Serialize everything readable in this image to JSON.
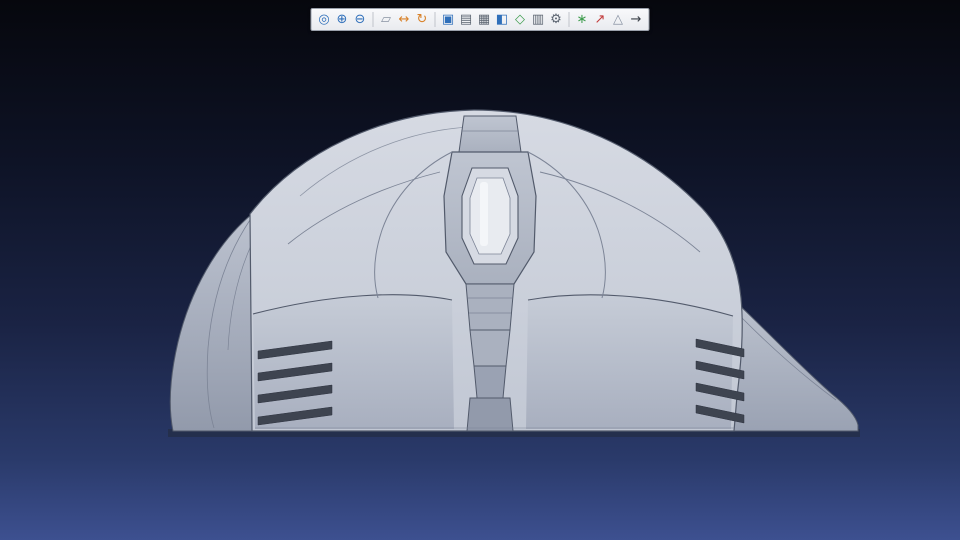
{
  "window": {
    "bg_top": "#06070d",
    "bg_bottom": "#3d5090"
  },
  "toolbar": {
    "items": [
      {
        "id": "zoom",
        "glyph": "◎",
        "color": "#2f6fba"
      },
      {
        "id": "zoom-in",
        "glyph": "⊕",
        "color": "#2f6fba"
      },
      {
        "id": "zoom-out",
        "glyph": "⊖",
        "color": "#2f6fba"
      },
      {
        "id": "sep-1",
        "type": "separator"
      },
      {
        "id": "zoom-area",
        "glyph": "▱",
        "color": "#8a93a3"
      },
      {
        "id": "pan",
        "glyph": "↔",
        "color": "#d8822a"
      },
      {
        "id": "rotate-view",
        "glyph": "↻",
        "color": "#d8822a"
      },
      {
        "id": "sep-2",
        "type": "separator"
      },
      {
        "id": "fit-view",
        "glyph": "▣",
        "color": "#2f6fba"
      },
      {
        "id": "named-views",
        "glyph": "▤",
        "color": "#5b6470"
      },
      {
        "id": "view-styles",
        "glyph": "▦",
        "color": "#5b6470"
      },
      {
        "id": "section-view",
        "glyph": "◧",
        "color": "#2f6fba"
      },
      {
        "id": "iso-view",
        "glyph": "◇",
        "color": "#3f9d4e"
      },
      {
        "id": "sheets",
        "glyph": "▥",
        "color": "#5b6470"
      },
      {
        "id": "display-settings",
        "glyph": "⚙",
        "color": "#5b6470"
      },
      {
        "id": "sep-3",
        "type": "separator"
      },
      {
        "id": "coordinate-triad",
        "glyph": "∗",
        "color": "#3f9d4e"
      },
      {
        "id": "orient",
        "glyph": "↗",
        "color": "#c23b3b"
      },
      {
        "id": "section-plane",
        "glyph": "△",
        "color": "#8a93a3"
      },
      {
        "id": "more-options",
        "glyph": "→",
        "color": "#3a4048"
      }
    ]
  },
  "viewport": {
    "model": "gaming-mouse-front-view",
    "colors": {
      "bg_top": "#06070d",
      "bg_bottom": "#3d5090",
      "body_light": "#d6dae3",
      "body": "#c2c8d4",
      "panel_top": "#c6ccd7",
      "panel_bottom": "#a8afbf",
      "wing_top": "#bcc2cf",
      "wing_bottom": "#929aab",
      "tail_top": "#bcc2ce",
      "tail_bottom": "#9aa2b3",
      "console": "#bfc5d1",
      "console_dark": "#aab1bf",
      "inner_panel": "#e8ebf0",
      "highlight": "#f5f7fa",
      "outline": "#525a6b",
      "outline_soft": "#7c8496",
      "vent": "#3e4450",
      "shadow": "#232a3a"
    }
  }
}
